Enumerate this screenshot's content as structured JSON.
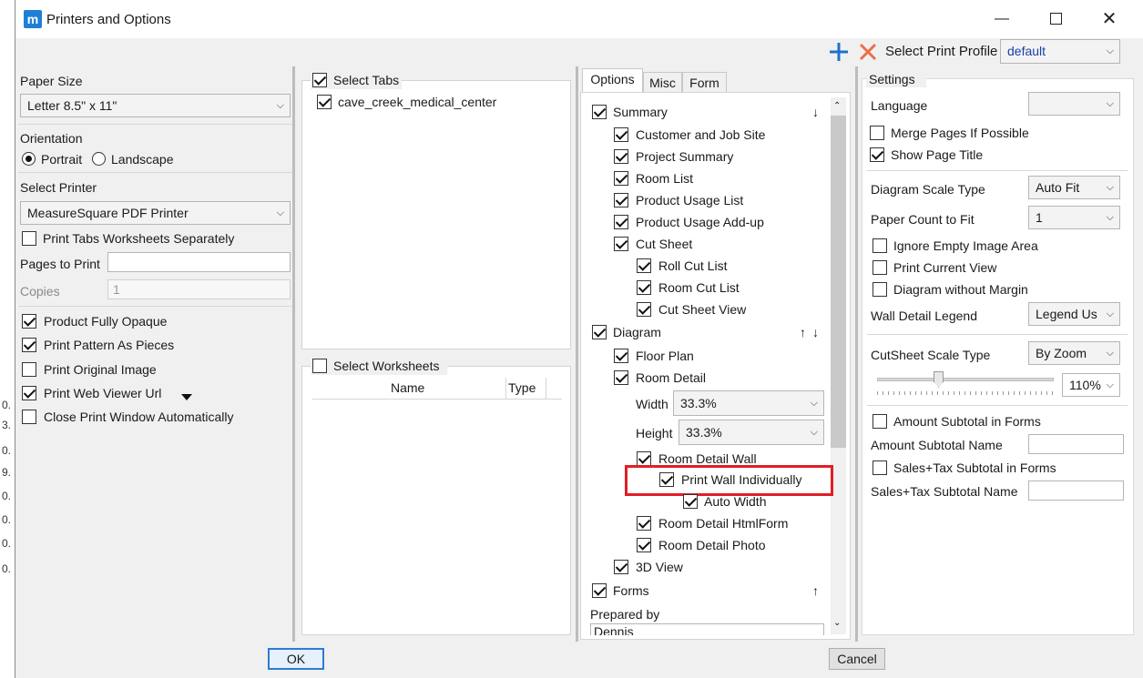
{
  "window": {
    "title": "Printers and Options",
    "app_icon": "m"
  },
  "toolbar": {
    "select_profile_label": "Select Print Profile",
    "profile_value": "default"
  },
  "left": {
    "paper_size_label": "Paper Size",
    "paper_size_value": "Letter 8.5\" x 11\"",
    "orientation_label": "Orientation",
    "portrait_label": "Portrait",
    "landscape_label": "Landscape",
    "select_printer_label": "Select Printer",
    "printer_value": "MeasureSquare PDF Printer",
    "print_tabs_separately": "Print Tabs Worksheets Separately",
    "pages_to_print_label": "Pages to Print",
    "pages_to_print_value": "",
    "copies_label": "Copies",
    "copies_value": "1",
    "product_fully_opaque": "Product Fully Opaque",
    "print_pattern_as_pieces": "Print Pattern As Pieces",
    "print_original_image": "Print Original Image",
    "print_web_viewer_url": "Print Web Viewer Url",
    "close_print_window": "Close Print Window Automatically"
  },
  "tabs_panel": {
    "select_tabs_label": "Select Tabs",
    "tab_item": "cave_creek_medical_center",
    "select_worksheets_label": "Select Worksheets",
    "col_name": "Name",
    "col_type": "Type"
  },
  "options": {
    "tabs": [
      "Options",
      "Misc",
      "Form"
    ],
    "summary": "Summary",
    "customer_job_site": "Customer and Job Site",
    "project_summary": "Project Summary",
    "room_list": "Room List",
    "product_usage_list": "Product Usage List",
    "product_usage_addup": "Product Usage Add-up",
    "cut_sheet": "Cut Sheet",
    "roll_cut_list": "Roll Cut List",
    "room_cut_list": "Room Cut List",
    "cut_sheet_view": "Cut Sheet View",
    "diagram": "Diagram",
    "floor_plan": "Floor Plan",
    "room_detail": "Room Detail",
    "width_label": "Width",
    "width_value": "33.3%",
    "height_label": "Height",
    "height_value": "33.3%",
    "room_detail_wall": "Room Detail Wall",
    "print_wall_individually": "Print Wall Individually",
    "auto_width": "Auto Width",
    "room_detail_htmlform": "Room Detail HtmlForm",
    "room_detail_photo": "Room Detail Photo",
    "view_3d": "3D View",
    "forms": "Forms",
    "prepared_by_label": "Prepared by",
    "prepared_by_value": "Dennis",
    "arrow_down": "↓",
    "arrow_up": "↑"
  },
  "settings": {
    "title": "Settings",
    "language_label": "Language",
    "language_value": "",
    "merge_pages": "Merge Pages If Possible",
    "show_page_title": "Show Page Title",
    "diagram_scale_type_label": "Diagram Scale Type",
    "diagram_scale_type_value": "Auto Fit",
    "paper_count_label": "Paper Count to Fit",
    "paper_count_value": "1",
    "ignore_empty": "Ignore Empty Image Area",
    "print_current_view": "Print Current View",
    "diagram_without_margin": "Diagram without Margin",
    "wall_detail_legend_label": "Wall Detail Legend",
    "wall_detail_legend_value": "Legend Us",
    "cutsheet_scale_type_label": "CutSheet Scale Type",
    "cutsheet_scale_type_value": "By Zoom",
    "zoom_value": "110%",
    "amount_subtotal_forms": "Amount Subtotal in Forms",
    "amount_subtotal_name_label": "Amount Subtotal Name",
    "sales_tax_subtotal_forms": "Sales+Tax Subtotal in Forms",
    "sales_tax_subtotal_name_label": "Sales+Tax Subtotal Name"
  },
  "buttons": {
    "ok": "OK",
    "cancel": "Cancel"
  },
  "colors": {
    "accent": "#2d7bd6",
    "highlight": "#e01f26",
    "add": "#1f72c9",
    "remove": "#e8704a"
  }
}
